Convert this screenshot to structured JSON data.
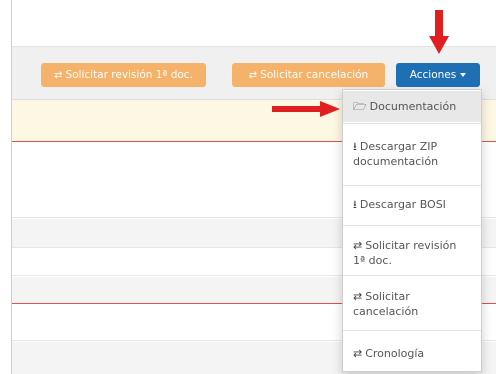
{
  "toolbar": {
    "btn_revision": {
      "label": "Solicitar revisión 1ª doc.",
      "icon": "exchange-icon"
    },
    "btn_cancel": {
      "label": "Solicitar cancelación",
      "icon": "exchange-icon"
    },
    "btn_actions": {
      "label": "Acciones"
    }
  },
  "dropdown": {
    "items": [
      {
        "label": "Documentación",
        "icon": "folder-open-icon",
        "glyph": "🗁"
      },
      {
        "label": "Descargar ZIP documentación",
        "icon": "download-icon",
        "glyph": "⭳"
      },
      {
        "label": "Descargar BOSI",
        "icon": "download-icon",
        "glyph": "⭳"
      },
      {
        "label": "Solicitar revisión 1ª doc.",
        "icon": "exchange-icon",
        "glyph": "⇄"
      },
      {
        "label": "Solicitar cancelación",
        "icon": "exchange-icon",
        "glyph": "⇄"
      },
      {
        "label": "Cronología",
        "icon": "exchange-icon",
        "glyph": "⇄"
      }
    ]
  },
  "colors": {
    "warning_button": "#f4b26a",
    "primary_button": "#1f6fb5",
    "annotation_arrow": "#e02020",
    "highlight_row": "#fcf8e3",
    "danger_line": "#d9534f"
  }
}
